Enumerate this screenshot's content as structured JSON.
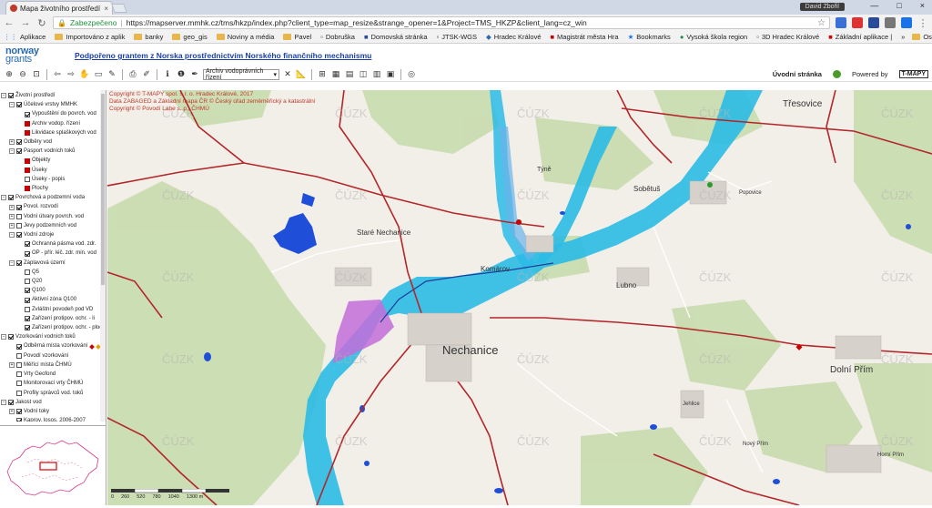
{
  "browser": {
    "tab_title": "Mapa životního prostředí",
    "tab_close": "×",
    "user": "David Zbořil",
    "window_buttons": [
      "—",
      "□",
      "×"
    ],
    "secure_label": "Zabezpečeno",
    "url": "https://mapserver.mmhk.cz/tms/hkzp/index.php?client_type=map_resize&strange_opener=1&Project=TMS_HKZP&client_lang=cz_win",
    "bookmarks": [
      "Aplikace",
      "Importováno z aplik",
      "banky",
      "geo_gis",
      "Noviny a média",
      "Pavel",
      "Dobruška",
      "Domovská stránka",
      "JTSK-WGS",
      "Hradec Králové",
      "Magistrát města Hra",
      "Bookmarks",
      "Vysoká škola region",
      "3D Hradec Králové",
      "Základní aplikace |"
    ],
    "bookmarks_more": "»",
    "other_bookmarks": "Ostatní záložky"
  },
  "header": {
    "logo_line1": "norway",
    "logo_line2": "grants",
    "grant_link": "Podpořeno grantem z Norska prostřednictvím Norského finančního mechanismu"
  },
  "toolbar": {
    "layer_select": "Archiv vodoprávních řízení",
    "home_label": "Úvodní stránka",
    "powered_by": "Powered by",
    "tmapy": "T-MAPY"
  },
  "tree": [
    {
      "label": "Životní prostředí",
      "level": 0,
      "exp": "−",
      "check": "on"
    },
    {
      "label": "Účelové vrstvy MMHK",
      "level": 1,
      "exp": "−",
      "check": "on"
    },
    {
      "label": "Vypouštění do povrch. vod",
      "level": 2,
      "exp": "",
      "check": "on"
    },
    {
      "label": "Archiv vodop. řízení",
      "level": 2,
      "exp": "",
      "check": "",
      "swatch": "#c00"
    },
    {
      "label": "Likvidace splaškových vod",
      "level": 2,
      "exp": "",
      "check": "",
      "swatch": "#c00"
    },
    {
      "label": "Odběry vod",
      "level": 1,
      "exp": "+",
      "check": "on"
    },
    {
      "label": "Pasport vodních toků",
      "level": 1,
      "exp": "−",
      "check": "on"
    },
    {
      "label": "Objekty",
      "level": 2,
      "exp": "",
      "check": "",
      "swatch": "#c00"
    },
    {
      "label": "Úseky",
      "level": 2,
      "exp": "",
      "check": "",
      "swatch": "#c00"
    },
    {
      "label": "Úseky - popis",
      "level": 2,
      "exp": "",
      "check": "off"
    },
    {
      "label": "Plochy",
      "level": 2,
      "exp": "",
      "check": "",
      "swatch": "#c00"
    },
    {
      "label": "Povrchová a podzemní voda",
      "level": 0,
      "exp": "−",
      "check": "on"
    },
    {
      "label": "Povol. rozvodí",
      "level": 1,
      "exp": "+",
      "check": "on"
    },
    {
      "label": "Vodní útvary povrch. vod",
      "level": 1,
      "exp": "+",
      "check": "off"
    },
    {
      "label": "Jevy podzemních vod",
      "level": 1,
      "exp": "+",
      "check": "off"
    },
    {
      "label": "Vodní zdroje",
      "level": 1,
      "exp": "−",
      "check": "on"
    },
    {
      "label": "Ochranná pásma vod. zdr.",
      "level": 2,
      "exp": "",
      "check": "on"
    },
    {
      "label": "OP - přír. léč. zdr. min. vod",
      "level": 2,
      "exp": "",
      "check": "on"
    },
    {
      "label": "Záplavová území",
      "level": 1,
      "exp": "−",
      "check": "on"
    },
    {
      "label": "Q5",
      "level": 2,
      "exp": "",
      "check": "off"
    },
    {
      "label": "Q20",
      "level": 2,
      "exp": "",
      "check": "off"
    },
    {
      "label": "Q100",
      "level": 2,
      "exp": "",
      "check": "on"
    },
    {
      "label": "Aktivní zóna Q100",
      "level": 2,
      "exp": "",
      "check": "on"
    },
    {
      "label": "Zvláštní povodeň pod VD",
      "level": 2,
      "exp": "",
      "check": "off"
    },
    {
      "label": "Zařízení protipov. ochr. - li",
      "level": 2,
      "exp": "",
      "check": "on"
    },
    {
      "label": "Zařízení protipov. ochr. - plocha",
      "level": 2,
      "exp": "",
      "check": "on"
    },
    {
      "label": "Vzorkování vodních toků",
      "level": 0,
      "exp": "−",
      "check": "on"
    },
    {
      "label": "Odběrná místa vzorkování",
      "level": 1,
      "exp": "",
      "check": "on",
      "dots": true
    },
    {
      "label": "Povodí vzorkování",
      "level": 1,
      "exp": "",
      "check": "off"
    },
    {
      "label": "Měřící místa ČHMÚ",
      "level": 1,
      "exp": "+",
      "check": "off"
    },
    {
      "label": "Vrty Geofond",
      "level": 1,
      "exp": "",
      "check": "off"
    },
    {
      "label": "Monitorovací vrty ČHMÚ",
      "level": 1,
      "exp": "",
      "check": "off"
    },
    {
      "label": "Profily správců vod. toků",
      "level": 1,
      "exp": "",
      "check": "off"
    },
    {
      "label": "Jakost vod",
      "level": 0,
      "exp": "−",
      "check": "on"
    },
    {
      "label": "Vodní toky",
      "level": 1,
      "exp": "+",
      "check": "on"
    },
    {
      "label": "Kaprov. losos. 2006-2007",
      "level": 1,
      "exp": "",
      "check": "on"
    }
  ],
  "map": {
    "copyright": [
      "Copyright © T-MAPY spol. s r. o. Hradec Králové, 2017",
      "Data ZABAGED a Základní mapa ČR © Český úřad zeměměřický a katastrální",
      "Copyright © Povodí Labe s. p., ČHMÚ"
    ],
    "watermark": "ČÚZK",
    "places": [
      {
        "name": "Třesovice",
        "size": 10
      },
      {
        "name": "Týně",
        "size": 7
      },
      {
        "name": "Sobětuš",
        "size": 8
      },
      {
        "name": "Popovice",
        "size": 6
      },
      {
        "name": "Staré Nechanice",
        "size": 8
      },
      {
        "name": "Komárov",
        "size": 8
      },
      {
        "name": "Lubno",
        "size": 8
      },
      {
        "name": "Nechanice",
        "size": 13
      },
      {
        "name": "Dolní Přím",
        "size": 10
      },
      {
        "name": "Jehlice",
        "size": 6
      },
      {
        "name": "Nový Přím",
        "size": 6
      },
      {
        "name": "Horní Přím",
        "size": 6
      }
    ],
    "scale_labels": [
      "0",
      "260",
      "520",
      "780",
      "1040",
      "1300 m"
    ]
  },
  "colors": {
    "flood": "#2bbbe6",
    "flood_zone": "#3b9fd6",
    "road": "#b3262a",
    "forest": "#c8dcae",
    "protection": "#c36dd8",
    "ponds": "#1f4fd8"
  }
}
